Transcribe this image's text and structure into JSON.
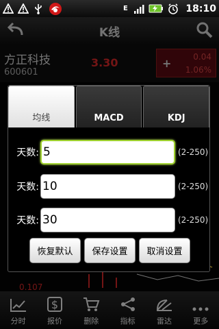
{
  "status_bar": {
    "time": "18:10",
    "icons": [
      "warning-icon",
      "warning-icon",
      "usb-icon",
      "app-logo-icon",
      "network-e-icon",
      "signal-icon",
      "battery-charging-icon",
      "alarm-icon"
    ],
    "network_letter": "E"
  },
  "header": {
    "title": "K线"
  },
  "stock": {
    "name": "方正科技",
    "code": "600601",
    "price": "3.30",
    "change": "0.04",
    "change_percent": "1.06%",
    "change_sign": "+",
    "bottom_value": "0.107"
  },
  "dialog": {
    "tabs": [
      {
        "label": "均线",
        "active": true
      },
      {
        "label": "MACD",
        "active": false
      },
      {
        "label": "KDJ",
        "active": false
      }
    ],
    "fields": [
      {
        "label": "天数:",
        "value": "5",
        "range": "(2-250)"
      },
      {
        "label": "天数:",
        "value": "10",
        "range": "(2-250)"
      },
      {
        "label": "天数:",
        "value": "30",
        "range": "(2-250)"
      }
    ],
    "buttons": {
      "reset": "恢复默认",
      "save": "保存设置",
      "cancel": "取消设置"
    }
  },
  "bottom_nav": {
    "items": [
      {
        "label": "分时",
        "icon": "timeshare-chart-icon"
      },
      {
        "label": "报价",
        "icon": "dollar-icon"
      },
      {
        "label": "删除",
        "icon": "cart-icon"
      },
      {
        "label": "指标",
        "icon": "share-icon"
      },
      {
        "label": "雷达",
        "icon": "radar-icon"
      },
      {
        "label": "更多",
        "icon": "more-icon"
      }
    ]
  },
  "colors": {
    "price_red": "#ff3030",
    "focus_green": "#9fd12f",
    "change_box_bg": "#6a0c14"
  }
}
